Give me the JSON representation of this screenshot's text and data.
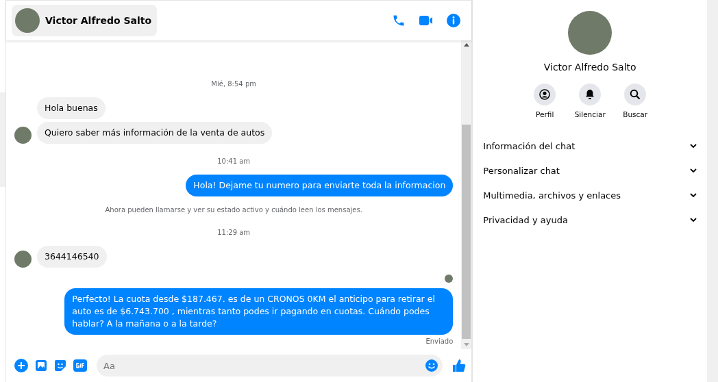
{
  "header": {
    "name": "Victor Alfredo Salto"
  },
  "messages": [
    {
      "kind": "time",
      "text": "Mié, 8:54 pm"
    },
    {
      "kind": "in",
      "text": "Hola buenas",
      "show_avatar": false
    },
    {
      "kind": "in",
      "text": "Quiero saber más información de la venta de autos",
      "show_avatar": true
    },
    {
      "kind": "time",
      "text": "10:41 am"
    },
    {
      "kind": "out",
      "text": "Hola! Dejame tu numero  para enviarte toda la informacion"
    },
    {
      "kind": "notice",
      "text": "Ahora pueden llamarse y ver su estado activo y cuándo leen los mensajes."
    },
    {
      "kind": "time",
      "text": "11:29 am"
    },
    {
      "kind": "in",
      "text": "3644146540",
      "show_avatar": true
    },
    {
      "kind": "seen"
    },
    {
      "kind": "out",
      "text": "Perfecto! La cuota desde $187.467. es de un CRONOS 0KM el anticipo para retirar el auto es de $6.743.700 , mientras tanto podes ir pagando en cuotas. Cuándo podes hablar? A la mañana o a la tarde?"
    },
    {
      "kind": "status",
      "text": "Enviado"
    }
  ],
  "composer": {
    "placeholder": "Aa"
  },
  "profile": {
    "name": "Victor Alfredo Salto",
    "actions": [
      {
        "kind": "profile",
        "label": "Perfil"
      },
      {
        "kind": "mute",
        "label": "Silenciar"
      },
      {
        "kind": "search",
        "label": "Buscar"
      }
    ],
    "sections": [
      {
        "label": "Información del chat",
        "expanded": false
      },
      {
        "label": "Personalizar chat",
        "expanded": false
      },
      {
        "label": "Multimedia, archivos y enlaces",
        "expanded": false
      },
      {
        "label": "Privacidad y ayuda",
        "expanded": false
      }
    ]
  }
}
